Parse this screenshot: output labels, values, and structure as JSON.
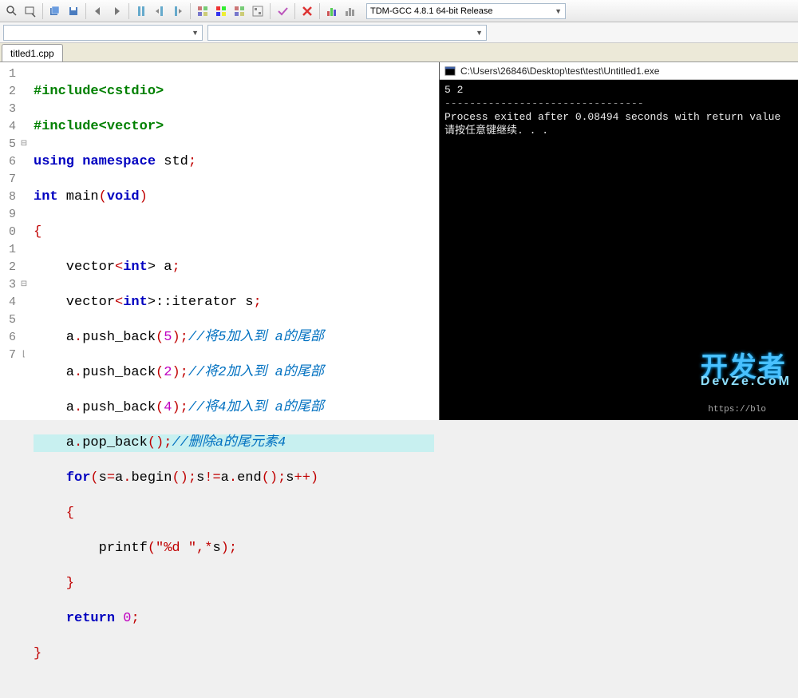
{
  "toolbar": {
    "compiler_label": "TDM-GCC 4.8.1 64-bit Release",
    "icons": [
      "zoom-in-icon",
      "find-icon",
      "sep",
      "save-all-icon",
      "save-icon",
      "sep",
      "indent-left-icon",
      "indent-right-icon",
      "sep",
      "bookmark-icon",
      "bookmark-prev-icon",
      "bookmark-next-icon",
      "sep",
      "grid1-icon",
      "grid2-icon",
      "grid3-icon",
      "grid4-icon",
      "sep",
      "check-icon",
      "sep",
      "cross-icon",
      "sep",
      "chart-icon",
      "profile-icon"
    ]
  },
  "tab": {
    "title": "titled1.cpp"
  },
  "editor": {
    "line_numbers": [
      "1",
      "2",
      "3",
      "4",
      "5",
      "6",
      "7",
      "8",
      "9",
      "0",
      "1",
      "2",
      "3",
      "4",
      "5",
      "6",
      "7"
    ],
    "fold_markers": [
      "",
      "",
      "",
      "",
      "⊟",
      "",
      "",
      "",
      "",
      "",
      "",
      "",
      "⊟",
      "",
      "",
      "",
      "⌊"
    ],
    "highlight_index": 10
  },
  "code": {
    "l1_a": "#include",
    "l1_b": "<cstdio>",
    "l2_a": "#include",
    "l2_b": "<vector>",
    "l3_a": "using",
    "l3_b": "namespace",
    "l3_c": " std",
    "l4_a": "int",
    "l4_b": " main",
    "l4_c": "void",
    "l5": "{",
    "l6_a": "    vector",
    "l6_b": "int",
    "l6_c": "> a",
    "l7_a": "    vector",
    "l7_b": "int",
    "l7_c": ">::iterator s",
    "l8_a": "    a",
    "l8_b": "push_back",
    "l8_n": "5",
    "l8_c": "//将5加入到 a的尾部",
    "l9_a": "    a",
    "l9_b": "push_back",
    "l9_n": "2",
    "l9_c": "//将2加入到 a的尾部",
    "l10_a": "    a",
    "l10_b": "push_back",
    "l10_n": "4",
    "l10_c": "//将4加入到 a的尾部",
    "l11_a": "    a",
    "l11_b": "pop_back",
    "l11_c": "//删除a的尾元素4",
    "l12_a": "for",
    "l12_b": "s",
    "l12_c": "=",
    "l12_d": "a",
    "l12_e": "begin",
    "l12_f": "s",
    "l12_g": "!=",
    "l12_h": "a",
    "l12_i": "end",
    "l12_j": "s",
    "l12_k": "++",
    "l13": "    {",
    "l14_a": "        printf",
    "l14_b": "\"%d \"",
    "l14_c": "*",
    "l14_d": "s",
    "l15": "    }",
    "l16_a": "return",
    "l16_b": "0",
    "l17": "}"
  },
  "console": {
    "title": "C:\\Users\\26846\\Desktop\\test\\test\\Untitled1.exe",
    "lines": [
      "5 2",
      "--------------------------------",
      "Process exited after 0.08494 seconds with return value",
      "请按任意键继续. . ."
    ],
    "status_url": "https://blo",
    "watermark_main": "开发者",
    "watermark_sub": "DevZe.CoM"
  }
}
